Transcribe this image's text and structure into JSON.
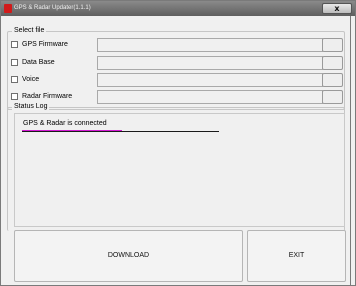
{
  "window": {
    "title": "GPS & Radar Updater(1.1.1)",
    "close_label": "x"
  },
  "select_file": {
    "legend": "Select file",
    "items": [
      {
        "label": "GPS Firmware"
      },
      {
        "label": "Data Base"
      },
      {
        "label": "Voice"
      },
      {
        "label": "Radar Firmware"
      }
    ]
  },
  "status_log": {
    "legend": "Status Log",
    "lines": [
      "GPS & Radar is connected"
    ]
  },
  "actions": {
    "download_label": "DOWNLOAD",
    "exit_label": "EXIT"
  }
}
